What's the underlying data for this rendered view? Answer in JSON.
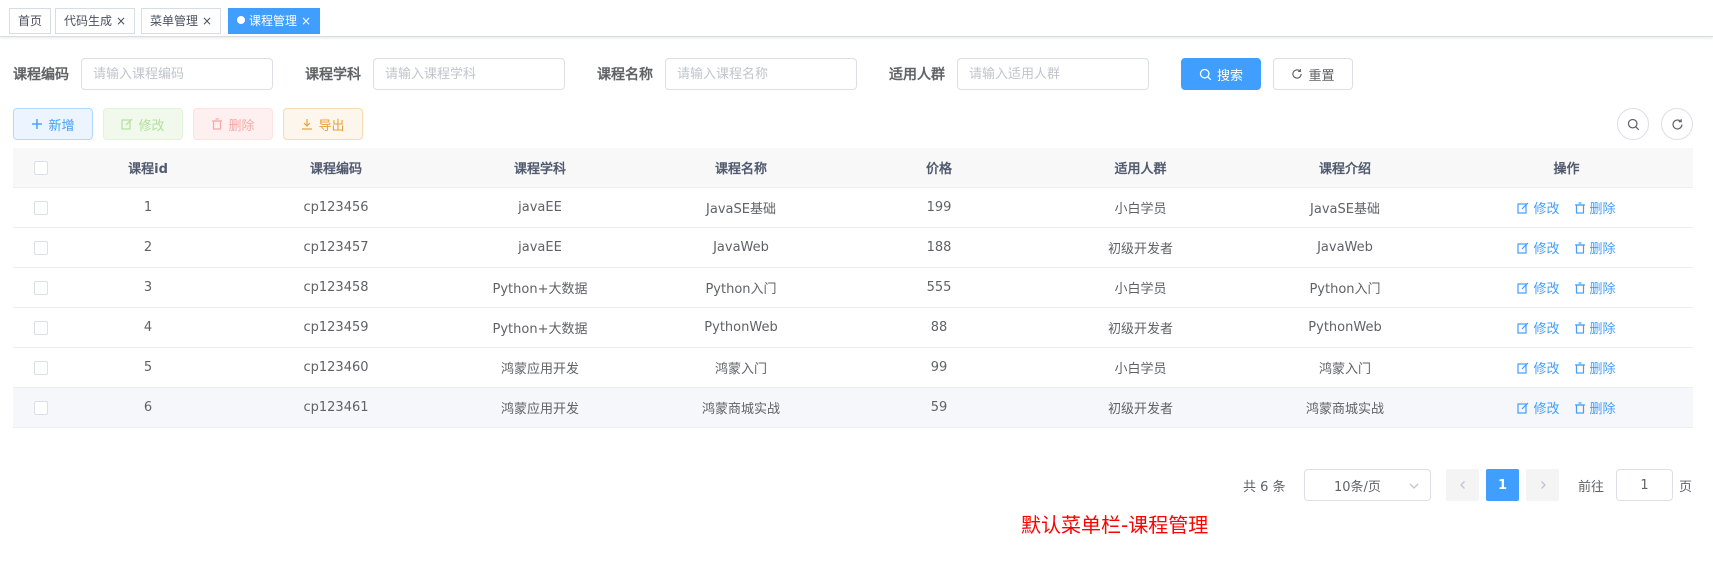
{
  "tabs": [
    {
      "label": "首页",
      "closable": false,
      "active": false
    },
    {
      "label": "代码生成",
      "closable": true,
      "active": false
    },
    {
      "label": "菜单管理",
      "closable": true,
      "active": false
    },
    {
      "label": "课程管理",
      "closable": true,
      "active": true
    }
  ],
  "search": {
    "fields": [
      {
        "label": "课程编码",
        "placeholder": "请输入课程编码",
        "value": ""
      },
      {
        "label": "课程学科",
        "placeholder": "请输入课程学科",
        "value": ""
      },
      {
        "label": "课程名称",
        "placeholder": "请输入课程名称",
        "value": ""
      },
      {
        "label": "适用人群",
        "placeholder": "请输入适用人群",
        "value": ""
      }
    ],
    "search_label": "搜索",
    "reset_label": "重置"
  },
  "toolbar": {
    "add_label": "新增",
    "edit_label": "修改",
    "delete_label": "删除",
    "export_label": "导出"
  },
  "table": {
    "columns": [
      "课程id",
      "课程编码",
      "课程学科",
      "课程名称",
      "价格",
      "适用人群",
      "课程介绍",
      "操作"
    ],
    "rows": [
      [
        "1",
        "cp123456",
        "javaEE",
        "JavaSE基础",
        "199",
        "小白学员",
        "JavaSE基础"
      ],
      [
        "2",
        "cp123457",
        "javaEE",
        "JavaWeb",
        "188",
        "初级开发者",
        "JavaWeb"
      ],
      [
        "3",
        "cp123458",
        "Python+大数据",
        "Python入门",
        "555",
        "小白学员",
        "Python入门"
      ],
      [
        "4",
        "cp123459",
        "Python+大数据",
        "PythonWeb",
        "88",
        "初级开发者",
        "PythonWeb"
      ],
      [
        "5",
        "cp123460",
        "鸿蒙应用开发",
        "鸿蒙入门",
        "99",
        "小白学员",
        "鸿蒙入门"
      ],
      [
        "6",
        "cp123461",
        "鸿蒙应用开发",
        "鸿蒙商城实战",
        "59",
        "初级开发者",
        "鸿蒙商城实战"
      ]
    ],
    "op_edit": "修改",
    "op_delete": "删除"
  },
  "pagination": {
    "total_text": "共 6 条",
    "page_size": "10条/页",
    "current_page": "1",
    "goto_label": "前往",
    "goto_value": "1",
    "page_suffix": "页"
  },
  "caption": "默认菜单栏-课程管理",
  "colors": {
    "primary": "#409eff",
    "caption": "#ff0000"
  }
}
